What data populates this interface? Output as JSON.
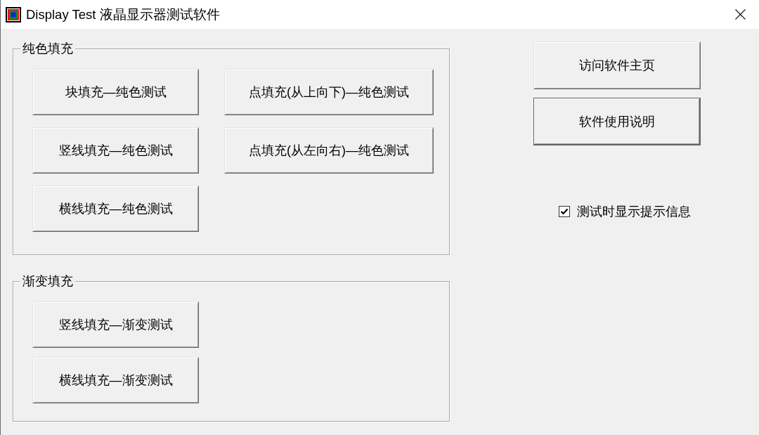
{
  "window": {
    "title": "Display Test 液晶显示器测试软件"
  },
  "groups": [
    {
      "title": "纯色填充",
      "columns": [
        [
          "块填充—纯色测试",
          "竖线填充—纯色测试",
          "横线填充—纯色测试"
        ],
        [
          "点填充(从上向下)—纯色测试",
          "点填充(从左向右)—纯色测试"
        ]
      ]
    },
    {
      "title": "渐变填充",
      "columns": [
        [
          "竖线填充—渐变测试",
          "横线填充—渐变测试"
        ]
      ]
    }
  ],
  "actions": [
    {
      "label": "访问软件主页",
      "default": false
    },
    {
      "label": "软件使用说明",
      "default": true
    }
  ],
  "options": [
    {
      "label": "测试时显示提示信息",
      "checked": true
    }
  ]
}
